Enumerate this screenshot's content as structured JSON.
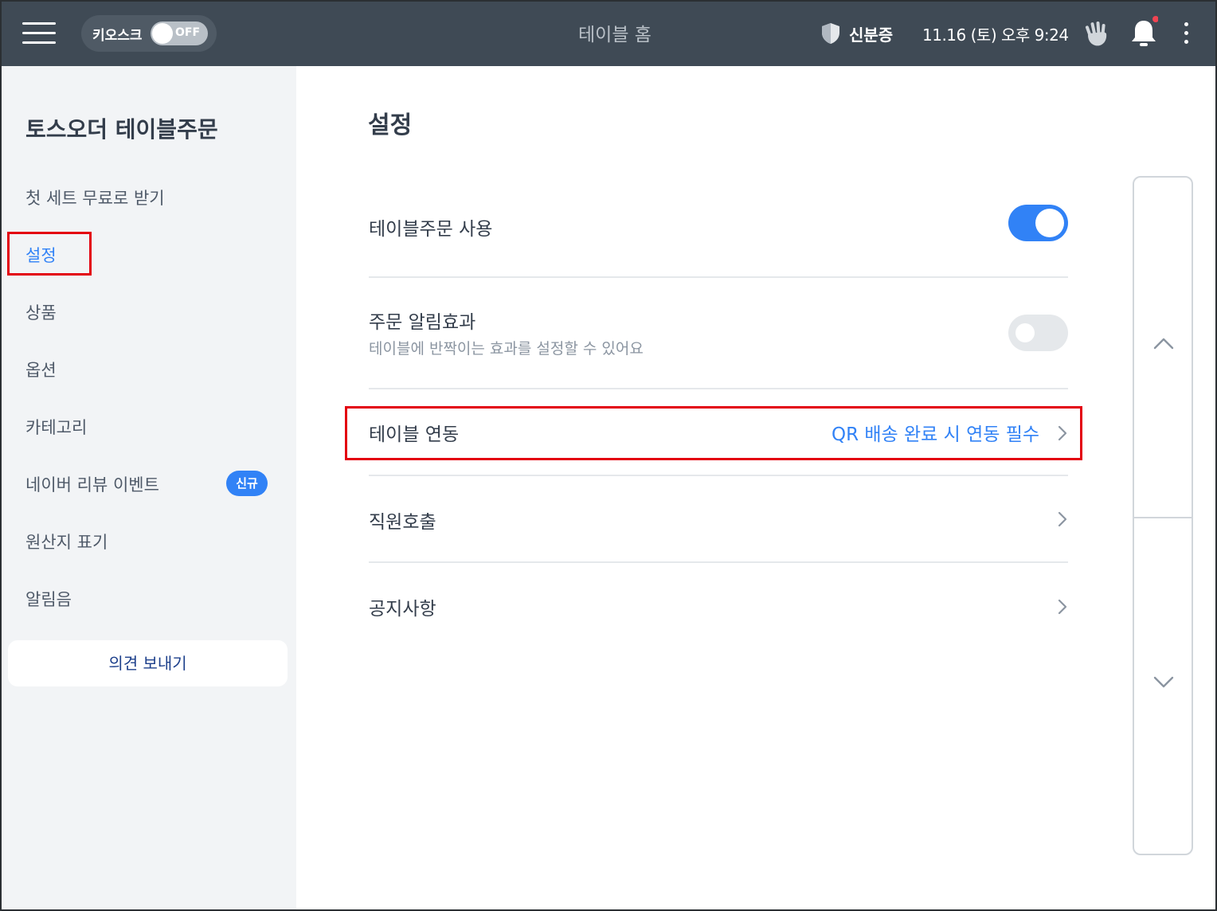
{
  "topbar": {
    "kiosk_label": "키오스크",
    "kiosk_state": "OFF",
    "title": "테이블 홈",
    "id_label": "신분증",
    "datetime": "11.16 (토) 오후 9:24",
    "bg_color": "#3f4a55",
    "notification_dot_color": "#f04452"
  },
  "sidebar": {
    "brand": "토스오더 테이블주문",
    "items": [
      {
        "label": "첫 세트 무료로 받기"
      },
      {
        "label": "설정"
      },
      {
        "label": "상품"
      },
      {
        "label": "옵션"
      },
      {
        "label": "카테고리"
      },
      {
        "label": "네이버 리뷰 이벤트",
        "badge": "신규"
      },
      {
        "label": "원산지 표기"
      },
      {
        "label": "알림음"
      }
    ],
    "feedback_label": "의견 보내기"
  },
  "main": {
    "title": "설정",
    "rows": [
      {
        "label": "테이블주문 사용",
        "toggle": "on"
      },
      {
        "label": "주문 알림효과",
        "sub": "테이블에 반짝이는 효과를 설정할 수 있어요",
        "toggle": "off"
      },
      {
        "label": "테이블 연동",
        "value": "QR 배송 완료 시 연동 필수"
      },
      {
        "label": "직원호출"
      },
      {
        "label": "공지사항"
      }
    ],
    "accent_color": "#3182f6",
    "highlight_color": "#e3000f"
  },
  "icons": {
    "menu": "hamburger-menu-icon",
    "shield": "shield-icon",
    "hand": "waving-hand-icon",
    "bell": "bell-icon",
    "more": "more-vertical-icon",
    "chevron_right": "chevron-right-icon",
    "scroll_up": "chevron-up-icon",
    "scroll_down": "chevron-down-icon"
  }
}
